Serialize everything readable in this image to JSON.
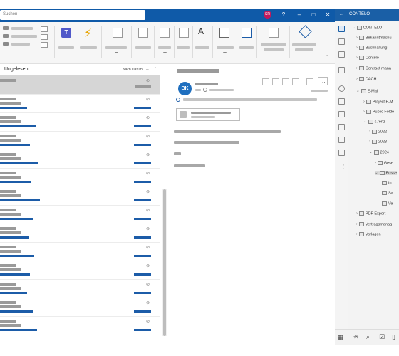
{
  "titlebar": {
    "search_placeholder": "Suchen",
    "user_initials": "SR",
    "window_buttons": {
      "help": "?",
      "minimize": "–",
      "maximize": "□",
      "close": "✕"
    }
  },
  "list": {
    "filter_label": "Ungelesen",
    "sort_label": "Nach Datum",
    "sort_direction_icon": "arrow-up-icon"
  },
  "reading": {
    "sender_initials": "BK"
  },
  "tree": {
    "root_label": "CONTELO",
    "items": [
      {
        "label": "Bekanntmachu"
      },
      {
        "label": "Buchhaltung"
      },
      {
        "label": "Contelo"
      },
      {
        "label": "Contract mana"
      },
      {
        "label": "DACH"
      },
      {
        "label": "E-Mail"
      },
      {
        "label": "Project E-M"
      },
      {
        "label": "Public Folde"
      },
      {
        "label": "s.renz"
      },
      {
        "label": "2022"
      },
      {
        "label": "2023"
      },
      {
        "label": "2024"
      },
      {
        "label": "Gese"
      },
      {
        "label": "Posse"
      },
      {
        "label": "In"
      },
      {
        "label": "Sa"
      },
      {
        "label": "Ve"
      },
      {
        "label": "PDF Export"
      },
      {
        "label": "Vertragsmanag"
      },
      {
        "label": "Vorlagen"
      }
    ]
  },
  "colors": {
    "accent_blue": "#0f5aa8",
    "avatar_blue": "#1f6fbf",
    "user_avatar": "#c2185b"
  }
}
